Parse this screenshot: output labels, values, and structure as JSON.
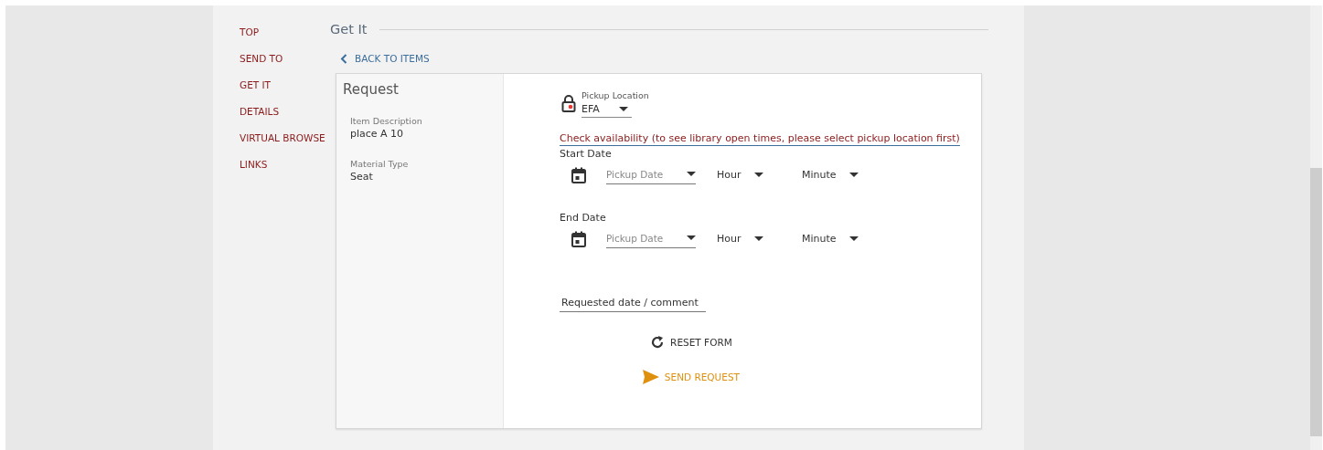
{
  "nav": [
    {
      "label": "TOP"
    },
    {
      "label": "SEND TO"
    },
    {
      "label": "GET IT"
    },
    {
      "label": "DETAILS"
    },
    {
      "label": "VIRTUAL BROWSE"
    },
    {
      "label": "LINKS"
    }
  ],
  "section_title": "Get It",
  "back_link": "BACK TO ITEMS",
  "request": {
    "title": "Request",
    "details": [
      {
        "label": "Item Description",
        "value": "place A 10"
      },
      {
        "label": "Material Type",
        "value": "Seat"
      }
    ]
  },
  "form": {
    "pickup_location": {
      "label": "Pickup Location",
      "value": "EFA"
    },
    "availability_link": "Check availability (to see library open times, please select pickup location first)",
    "date_rows": [
      {
        "label": "Start Date",
        "date_placeholder": "Pickup Date",
        "hour": "Hour",
        "minute": "Minute"
      },
      {
        "label": "End Date",
        "date_placeholder": "Pickup Date",
        "hour": "Hour",
        "minute": "Minute"
      }
    ],
    "comment_placeholder": "Requested date / comment",
    "reset_button": "RESET FORM",
    "send_button": "SEND REQUEST"
  }
}
